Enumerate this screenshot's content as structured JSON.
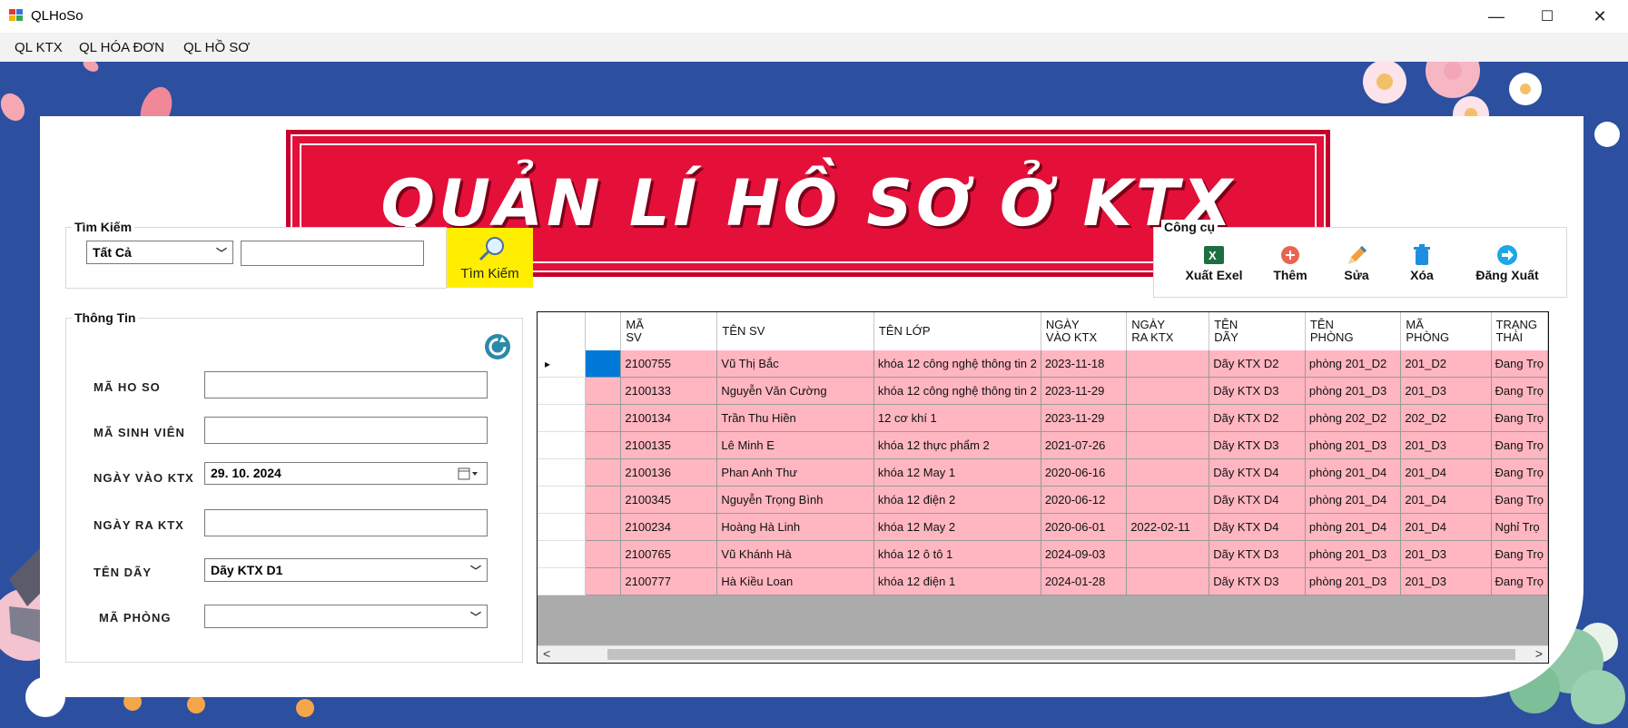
{
  "window": {
    "title": "QLHoSo",
    "min": "—",
    "max": "☐",
    "close": "✕"
  },
  "menu": [
    "QL KTX",
    "QL HÓA ĐƠN",
    "QL HỒ SƠ"
  ],
  "banner": {
    "text": "QUẢN LÍ HỒ SƠ Ở KTX"
  },
  "search": {
    "legend": "Tìm Kiếm",
    "filter_value": "Tất Cả",
    "query_value": "",
    "button_label": "Tìm Kiếm",
    "icon": "magnifier-icon"
  },
  "tools": {
    "legend": "Công cụ",
    "items": [
      {
        "label": "Xuất Exel",
        "icon": "excel-icon",
        "color": "#1d6f42"
      },
      {
        "label": "Thêm",
        "icon": "add-icon",
        "color": "#e8654f"
      },
      {
        "label": "Sửa",
        "icon": "pencil-icon",
        "color": "#e07a2f"
      },
      {
        "label": "Xóa",
        "icon": "trash-icon",
        "color": "#1e8fe0"
      },
      {
        "label": "Đăng Xuất",
        "icon": "logout-icon",
        "color": "#1ea6e8"
      }
    ]
  },
  "info": {
    "legend": "Thông Tin",
    "refresh_icon": "refresh-icon",
    "fields": {
      "ma_ho_so": {
        "label": "MÃ HO SO",
        "value": ""
      },
      "ma_sinh_vien": {
        "label": "MÃ SINH VIÊN",
        "value": ""
      },
      "ngay_vao": {
        "label": "NGÀY VÀO KTX",
        "value": "29. 10. 2024"
      },
      "ngay_ra": {
        "label": "NGÀY RA KTX",
        "value": ""
      },
      "ten_day": {
        "label": "TÊN DÃY",
        "value": "Dãy KTX D1"
      },
      "ma_phong": {
        "label": "MÃ PHÒNG",
        "value": ""
      }
    }
  },
  "grid": {
    "columns": [
      [
        "MÃ",
        "SV"
      ],
      [
        "TÊN SV"
      ],
      [
        "TÊN LỚP"
      ],
      [
        "NGÀY",
        "VÀO KTX"
      ],
      [
        "NGÀY",
        "RA KTX"
      ],
      [
        "TÊN",
        "DÃY"
      ],
      [
        "TÊN",
        "PHÒNG"
      ],
      [
        "MÃ",
        "PHÒNG"
      ],
      [
        "TRẠNG",
        "THÁI"
      ]
    ],
    "rows": [
      [
        "2100755",
        "Vũ Thị Bắc",
        "khóa 12 công nghệ thông tin 2",
        "2023-11-18",
        "",
        "Dãy KTX D2",
        "phòng 201_D2",
        "201_D2",
        "Đang Trọ"
      ],
      [
        "2100133",
        "Nguyễn Văn Cường",
        "khóa 12 công nghệ thông tin 2",
        "2023-11-29",
        "",
        "Dãy KTX D3",
        "phòng 201_D3",
        "201_D3",
        "Đang Trọ"
      ],
      [
        "2100134",
        "Trần Thu Hiền",
        "12 cơ khí 1",
        "2023-11-29",
        "",
        "Dãy KTX D2",
        "phòng 202_D2",
        "202_D2",
        "Đang Trọ"
      ],
      [
        "2100135",
        "Lê Minh E",
        "khóa 12 thực phẩm 2",
        "2021-07-26",
        "",
        "Dãy KTX D3",
        "phòng 201_D3",
        "201_D3",
        "Đang Trọ"
      ],
      [
        "2100136",
        "Phan Anh Thư",
        "khóa 12 May 1",
        "2020-06-16",
        "",
        "Dãy KTX D4",
        "phòng 201_D4",
        "201_D4",
        "Đang Trọ"
      ],
      [
        "2100345",
        "Nguyễn Trọng Bình",
        "khóa 12 điện 2",
        "2020-06-12",
        "",
        "Dãy KTX D4",
        "phòng 201_D4",
        "201_D4",
        "Đang Trọ"
      ],
      [
        "2100234",
        "Hoàng Hà Linh",
        "khóa 12 May 2",
        "2020-06-01",
        "2022-02-11",
        "Dãy KTX D4",
        "phòng 201_D4",
        "201_D4",
        "Nghỉ Trọ"
      ],
      [
        "2100765",
        "Vũ Khánh Hà",
        "khóa 12 ô tô 1",
        "2024-09-03",
        "",
        "Dãy KTX D3",
        "phòng 201_D3",
        "201_D3",
        "Đang Trọ"
      ],
      [
        "2100777",
        "Hà Kiều Loan",
        "khóa 12 điện 1",
        "2024-01-28",
        "",
        "Dãy KTX D3",
        "phòng 201_D3",
        "201_D3",
        "Đang Trọ"
      ]
    ],
    "current_row_marker": "▸",
    "scroll_left": "<",
    "scroll_right": ">"
  },
  "colors": {
    "row_bg": "#ffb6c1",
    "selected_cell": "#0078d7",
    "search_button": "#ffee00",
    "background": "#2c4fa0"
  }
}
